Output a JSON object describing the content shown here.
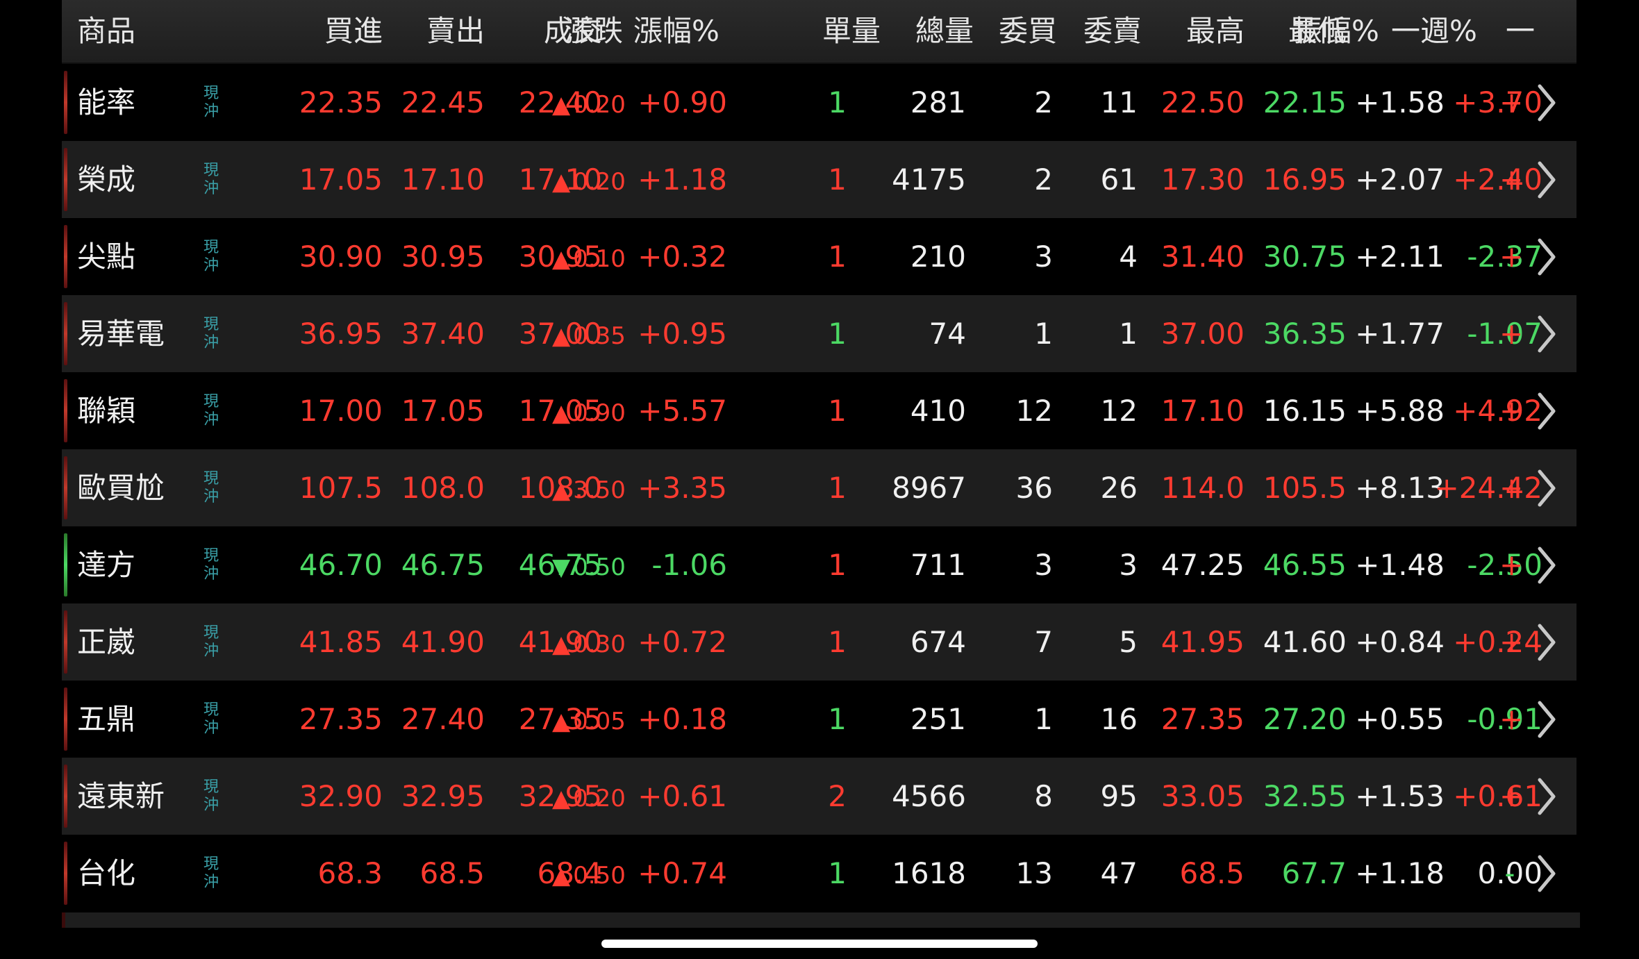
{
  "header": {
    "product": "商品",
    "bid": "買進",
    "ask": "賣出",
    "last": "成交",
    "change": "漲跌",
    "change_pct": "漲幅%",
    "single_vol": "單量",
    "total_vol": "總量",
    "bid_qty": "委買",
    "ask_qty": "委賣",
    "high": "最高",
    "low": "最低",
    "amplitude": "振幅%",
    "week_pct": "一週%",
    "extra": "一"
  },
  "rows": [
    {
      "name": "能率",
      "tag": "現沖",
      "bid": "22.35",
      "ask": "22.45",
      "last": "22.40",
      "dir": "up",
      "change": "0.20",
      "change_pct": "+0.90",
      "single": "1",
      "total": "281",
      "bid_qty": "2",
      "ask_qty": "11",
      "high": "22.50",
      "low": "22.15",
      "amp": "+1.58",
      "week": "+3.70",
      "extra": "+",
      "c": {
        "bid": "red",
        "ask": "red",
        "last": "red",
        "pct": "red",
        "single": "green",
        "high": "red",
        "low": "green",
        "week": "red",
        "extra": "red",
        "marker": "red"
      }
    },
    {
      "name": "榮成",
      "tag": "現沖",
      "bid": "17.05",
      "ask": "17.10",
      "last": "17.10",
      "dir": "up",
      "change": "0.20",
      "change_pct": "+1.18",
      "single": "1",
      "total": "4175",
      "bid_qty": "2",
      "ask_qty": "61",
      "high": "17.30",
      "low": "16.95",
      "amp": "+2.07",
      "week": "+2.40",
      "extra": "+",
      "c": {
        "bid": "red",
        "ask": "red",
        "last": "red",
        "pct": "red",
        "single": "red",
        "high": "red",
        "low": "red",
        "week": "red",
        "extra": "red",
        "marker": "red"
      }
    },
    {
      "name": "尖點",
      "tag": "現沖",
      "bid": "30.90",
      "ask": "30.95",
      "last": "30.95",
      "dir": "up",
      "change": "0.10",
      "change_pct": "+0.32",
      "single": "1",
      "total": "210",
      "bid_qty": "3",
      "ask_qty": "4",
      "high": "31.40",
      "low": "30.75",
      "amp": "+2.11",
      "week": "-2.37",
      "extra": "+",
      "c": {
        "bid": "red",
        "ask": "red",
        "last": "red",
        "pct": "red",
        "single": "red",
        "high": "red",
        "low": "green",
        "week": "green",
        "extra": "red",
        "marker": "red"
      }
    },
    {
      "name": "易華電",
      "tag": "現沖",
      "bid": "36.95",
      "ask": "37.40",
      "last": "37.00",
      "dir": "up",
      "change": "0.35",
      "change_pct": "+0.95",
      "single": "1",
      "total": "74",
      "bid_qty": "1",
      "ask_qty": "1",
      "high": "37.00",
      "low": "36.35",
      "amp": "+1.77",
      "week": "-1.07",
      "extra": "+",
      "c": {
        "bid": "red",
        "ask": "red",
        "last": "red",
        "pct": "red",
        "single": "green",
        "high": "red",
        "low": "green",
        "week": "green",
        "extra": "red",
        "marker": "red"
      }
    },
    {
      "name": "聯穎",
      "tag": "現沖",
      "bid": "17.00",
      "ask": "17.05",
      "last": "17.05",
      "dir": "up",
      "change": "0.90",
      "change_pct": "+5.57",
      "single": "1",
      "total": "410",
      "bid_qty": "12",
      "ask_qty": "12",
      "high": "17.10",
      "low": "16.15",
      "amp": "+5.88",
      "week": "+4.92",
      "extra": "+",
      "c": {
        "bid": "red",
        "ask": "red",
        "last": "red",
        "pct": "red",
        "single": "red",
        "high": "red",
        "low": "white",
        "week": "red",
        "extra": "red",
        "marker": "red"
      }
    },
    {
      "name": "歐買尬",
      "tag": "現沖",
      "bid": "107.5",
      "ask": "108.0",
      "last": "108.0",
      "dir": "up",
      "change": "3.50",
      "change_pct": "+3.35",
      "single": "1",
      "total": "8967",
      "bid_qty": "36",
      "ask_qty": "26",
      "high": "114.0",
      "low": "105.5",
      "amp": "+8.13",
      "week": "+24.42",
      "extra": "+3",
      "c": {
        "bid": "red",
        "ask": "red",
        "last": "red",
        "pct": "red",
        "single": "red",
        "high": "red",
        "low": "red",
        "week": "red",
        "extra": "red",
        "marker": "red"
      }
    },
    {
      "name": "達方",
      "tag": "現沖",
      "bid": "46.70",
      "ask": "46.75",
      "last": "46.75",
      "dir": "down",
      "change": "0.50",
      "change_pct": "-1.06",
      "single": "1",
      "total": "711",
      "bid_qty": "3",
      "ask_qty": "3",
      "high": "47.25",
      "low": "46.55",
      "amp": "+1.48",
      "week": "-2.50",
      "extra": "+",
      "c": {
        "bid": "green",
        "ask": "green",
        "last": "green",
        "pct": "green",
        "single": "red",
        "high": "white",
        "low": "green",
        "week": "green",
        "extra": "red",
        "marker": "green"
      }
    },
    {
      "name": "正崴",
      "tag": "現沖",
      "bid": "41.85",
      "ask": "41.90",
      "last": "41.90",
      "dir": "up",
      "change": "0.30",
      "change_pct": "+0.72",
      "single": "1",
      "total": "674",
      "bid_qty": "7",
      "ask_qty": "5",
      "high": "41.95",
      "low": "41.60",
      "amp": "+0.84",
      "week": "+0.24",
      "extra": "+",
      "c": {
        "bid": "red",
        "ask": "red",
        "last": "red",
        "pct": "red",
        "single": "red",
        "high": "red",
        "low": "white",
        "week": "red",
        "extra": "red",
        "marker": "red"
      }
    },
    {
      "name": "五鼎",
      "tag": "現沖",
      "bid": "27.35",
      "ask": "27.40",
      "last": "27.35",
      "dir": "up",
      "change": "0.05",
      "change_pct": "+0.18",
      "single": "1",
      "total": "251",
      "bid_qty": "1",
      "ask_qty": "16",
      "high": "27.35",
      "low": "27.20",
      "amp": "+0.55",
      "week": "-0.91",
      "extra": "+",
      "c": {
        "bid": "red",
        "ask": "red",
        "last": "red",
        "pct": "red",
        "single": "green",
        "high": "red",
        "low": "green",
        "week": "green",
        "extra": "red",
        "marker": "red"
      }
    },
    {
      "name": "遠東新",
      "tag": "現沖",
      "bid": "32.90",
      "ask": "32.95",
      "last": "32.95",
      "dir": "up",
      "change": "0.20",
      "change_pct": "+0.61",
      "single": "2",
      "total": "4566",
      "bid_qty": "8",
      "ask_qty": "95",
      "high": "33.05",
      "low": "32.55",
      "amp": "+1.53",
      "week": "+0.61",
      "extra": "+",
      "c": {
        "bid": "red",
        "ask": "red",
        "last": "red",
        "pct": "red",
        "single": "red",
        "high": "red",
        "low": "green",
        "week": "red",
        "extra": "red",
        "marker": "red"
      }
    },
    {
      "name": "台化",
      "tag": "現沖",
      "bid": "68.3",
      "ask": "68.5",
      "last": "68.4",
      "dir": "up",
      "change": "0.50",
      "change_pct": "+0.74",
      "single": "1",
      "total": "1618",
      "bid_qty": "13",
      "ask_qty": "47",
      "high": "68.5",
      "low": "67.7",
      "amp": "+1.18",
      "week": "0.00",
      "extra": "-",
      "c": {
        "bid": "red",
        "ask": "red",
        "last": "red",
        "pct": "red",
        "single": "green",
        "high": "red",
        "low": "green",
        "week": "white",
        "extra": "green",
        "marker": "red"
      }
    }
  ],
  "colors": {
    "red": "#ff3b30",
    "green": "#4cd964",
    "white": "#f0f0f0",
    "teal": "#3aa0a8",
    "row_alt": "#1e1e1e"
  },
  "icons": {
    "row_action": "chevron-right-icon",
    "up": "triangle-up-icon",
    "down": "triangle-down-icon"
  }
}
